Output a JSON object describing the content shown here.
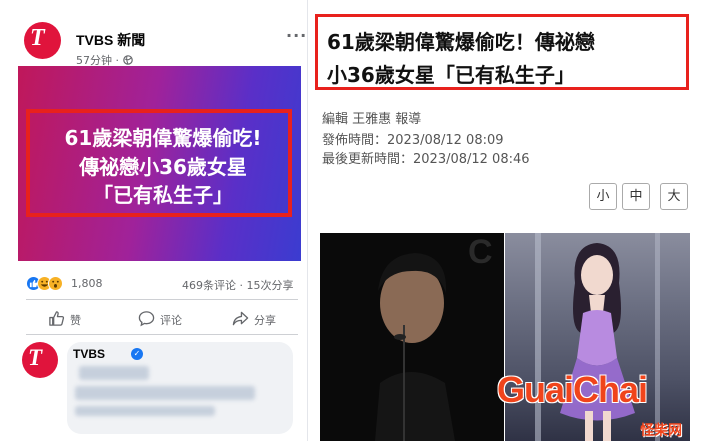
{
  "post": {
    "page_name": "TVBS 新聞",
    "time": "57分钟",
    "more": "···",
    "logo_text": "T",
    "banner_lines": [
      "61歲梁朝偉驚爆偷吃!",
      "傳祕戀小36歲女星",
      "「已有私生子」"
    ],
    "reaction_count": "1,808",
    "comments_shares": "469条评论 · 15次分享",
    "actions": {
      "like": "赞",
      "comment": "评论",
      "share": "分享"
    },
    "comment_author": "TVBS"
  },
  "article": {
    "title_lines": [
      "61歲梁朝偉驚爆偷吃！傳祕戀",
      "小36歲女星「已有私生子」"
    ],
    "editor": "編輯 王雅惠 報導",
    "published": "發佈時間：2023/08/12 08:09",
    "updated": "最後更新時間：2023/08/12 08:46",
    "font_sizes": [
      "小",
      "中",
      "大"
    ]
  },
  "watermark": {
    "main": "GuaiChai",
    "sub": "怪柴网"
  },
  "colors": {
    "fb_red": "#e0143c",
    "highlight": "#e8211d",
    "watermark": "#f0441b",
    "fb_blue": "#1877f2"
  }
}
